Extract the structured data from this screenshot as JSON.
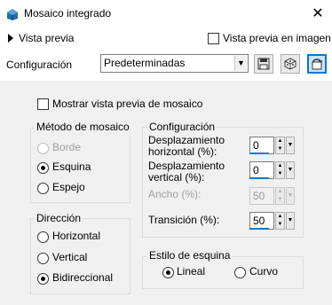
{
  "window": {
    "title": "Mosaico integrado",
    "close_symbol": "✕",
    "icon": "app-icon"
  },
  "preview": {
    "toggle_label": "Vista previa",
    "in_image_label": "Vista previa en imagen",
    "in_image_checked": false
  },
  "config_row": {
    "label": "Configuración",
    "preset_value": "Predeterminadas",
    "buttons": [
      "save-icon",
      "random-dice-icon",
      "reset-icon"
    ]
  },
  "show_tile_preview": {
    "label": "Mostrar vista previa de mosaico",
    "checked": false
  },
  "tile_method": {
    "title": "Método de mosaico",
    "options": [
      "Borde",
      "Esquina",
      "Espejo"
    ],
    "selected": "Esquina",
    "disabled": [
      "Borde"
    ]
  },
  "direction": {
    "title": "Dirección",
    "options": [
      "Horizontal",
      "Vertical",
      "Bidireccional"
    ],
    "selected": "Bidireccional"
  },
  "settings": {
    "title": "Configuración",
    "horizontal_offset": {
      "label_line1": "Desplazamiento",
      "label_line2": "horizontal (%):",
      "value": "0"
    },
    "vertical_offset": {
      "label_line1": "Desplazamiento",
      "label_line2": "vertical (%):",
      "value": "0"
    },
    "width": {
      "label": "Ancho (%):",
      "value": "50",
      "disabled": true
    },
    "transition": {
      "label": "Transición (%):",
      "value": "50"
    }
  },
  "corner_style": {
    "title": "Estilo de esquina",
    "options": [
      "Lineal",
      "Curvo"
    ],
    "selected": "Lineal"
  },
  "colors": {
    "accent": "#0078d7",
    "panel_bg": "#f0f0f0"
  }
}
